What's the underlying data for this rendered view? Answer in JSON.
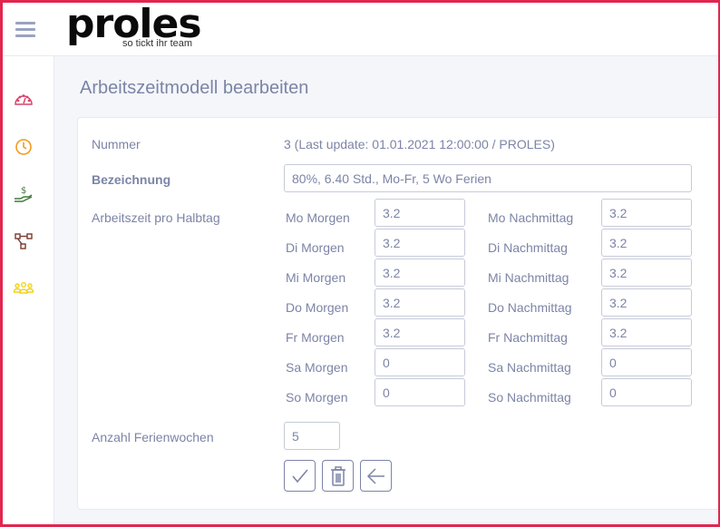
{
  "app": {
    "logo_text": "proles",
    "logo_tagline": "so tickt ihr team"
  },
  "sidebar": {
    "items": [
      {
        "icon": "dashboard-gauge-icon",
        "color": "#d9436b"
      },
      {
        "icon": "clock-icon",
        "color": "#f39a1e"
      },
      {
        "icon": "hand-money-icon",
        "color": "#3f7a3a"
      },
      {
        "icon": "hierarchy-icon",
        "color": "#7a3a2f"
      },
      {
        "icon": "team-icon",
        "color": "#f2d21c"
      }
    ]
  },
  "page": {
    "title": "Arbeitszeitmodell bearbeiten"
  },
  "form": {
    "nummer_label": "Nummer",
    "nummer_value": "3 (Last update: 01.01.2021 12:00:00 / PROLES)",
    "bezeichnung_label": "Bezeichnung",
    "bezeichnung_value": "80%, 6.40 Std., Mo-Fr, 5 Wo Ferien",
    "halbtag_label": "Arbeitszeit pro Halbtag",
    "days": [
      {
        "morning_label": "Mo Morgen",
        "morning_value": "3.2",
        "afternoon_label": "Mo Nachmittag",
        "afternoon_value": "3.2"
      },
      {
        "morning_label": "Di Morgen",
        "morning_value": "3.2",
        "afternoon_label": "Di Nachmittag",
        "afternoon_value": "3.2"
      },
      {
        "morning_label": "Mi Morgen",
        "morning_value": "3.2",
        "afternoon_label": "Mi Nachmittag",
        "afternoon_value": "3.2"
      },
      {
        "morning_label": "Do Morgen",
        "morning_value": "3.2",
        "afternoon_label": "Do Nachmittag",
        "afternoon_value": "3.2"
      },
      {
        "morning_label": "Fr Morgen",
        "morning_value": "3.2",
        "afternoon_label": "Fr Nachmittag",
        "afternoon_value": "3.2"
      },
      {
        "morning_label": "Sa Morgen",
        "morning_value": "0",
        "afternoon_label": "Sa Nachmittag",
        "afternoon_value": "0"
      },
      {
        "morning_label": "So Morgen",
        "morning_value": "0",
        "afternoon_label": "So Nachmittag",
        "afternoon_value": "0"
      }
    ],
    "ferien_label": "Anzahl Ferienwochen",
    "ferien_value": "5"
  },
  "actions": {
    "save_icon": "check-icon",
    "delete_icon": "trash-icon",
    "back_icon": "arrow-left-icon"
  },
  "colors": {
    "accent_border": "#e0264f",
    "text": "#7c84a6"
  }
}
